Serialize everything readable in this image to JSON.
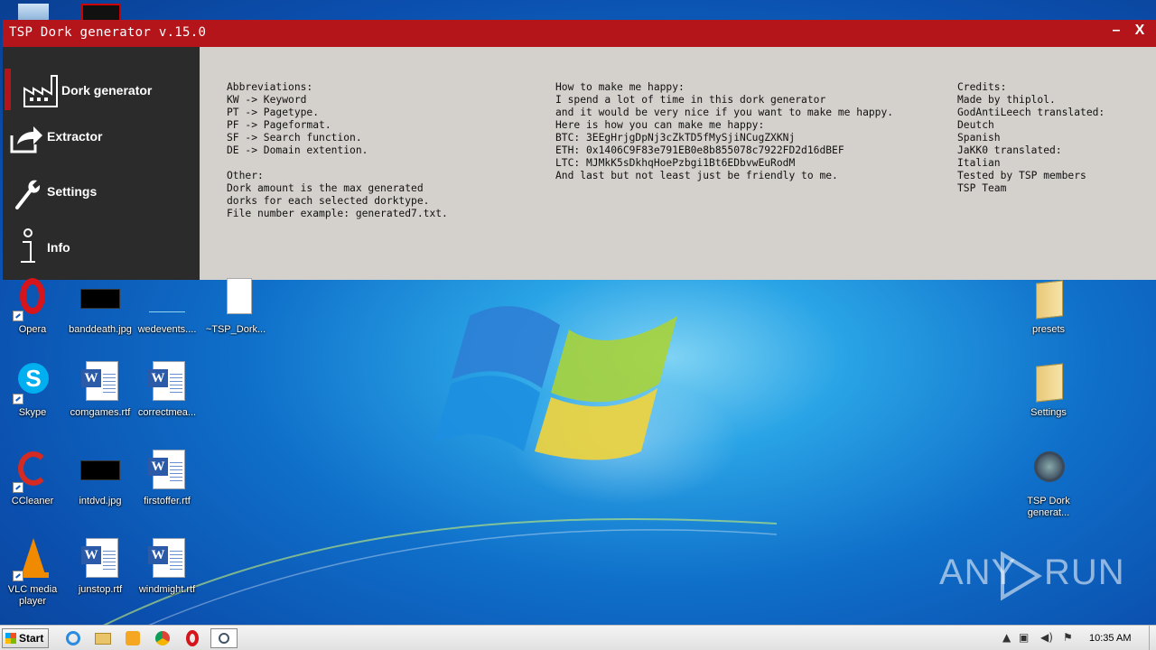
{
  "window": {
    "title": "TSP Dork generator v.15.0",
    "minimize_label": "–",
    "close_label": "X"
  },
  "sidebar": {
    "items": [
      {
        "label": "Dork generator",
        "icon": "factory-icon",
        "active": true
      },
      {
        "label": "Extractor",
        "icon": "export-icon"
      },
      {
        "label": "Settings",
        "icon": "wrench-icon"
      },
      {
        "label": "Info",
        "icon": "info-icon"
      }
    ]
  },
  "content": {
    "col1": "Abbreviations:\nKW -> Keyword\nPT -> Pagetype.\nPF -> Pageformat.\nSF -> Search function.\nDE -> Domain extention.\n\nOther:\nDork amount is the max generated\ndorks for each selected dorktype.\nFile number example: generated7.txt.",
    "col2": "How to make me happy:\nI spend a lot of time in this dork generator\nand it would be very nice if you want to make me happy.\nHere is how you can make me happy:\nBTC: 3EEgHrjgDpNj3cZkTD5fMySjiNCugZXKNj\nETH: 0x1406C9F83e791EB0e8b855078c7922FD2d16dBEF\nLTC: MJMkK5sDkhqHoePzbgi1Bt6EDbvwEuRodM\nAnd last but not least just be friendly to me.",
    "col3": "Credits:\nMade by thiplol.\nGodAntiLeech translated:\nDeutch\nSpanish\nJaKK0 translated:\nItalian\nTested by TSP members\nTSP Team"
  },
  "desktop_icons": {
    "opera": "Opera",
    "banddeath": "banddeath.jpg",
    "wedevents": "wedevents....",
    "tsp_dork_tmp": "~TSP_Dork...",
    "skype": "Skype",
    "comgames": "comgames.rtf",
    "correctmea": "correctmea...",
    "ccleaner": "CCleaner",
    "intdvd": "intdvd.jpg",
    "firstoffer": "firstoffer.rtf",
    "vlc": "VLC media player",
    "junstop": "junstop.rtf",
    "windmight": "windmight.rtf",
    "presets": "presets",
    "settings": "Settings",
    "tsp_dork": "TSP Dork generat..."
  },
  "taskbar": {
    "start_label": "Start",
    "clock": "10:35 AM"
  },
  "watermark": {
    "left": "ANY",
    "right": "RUN"
  },
  "colors": {
    "accent_red": "#b3151b",
    "sidebar_bg": "#2b2b2b",
    "content_bg": "#d4d0cc"
  }
}
